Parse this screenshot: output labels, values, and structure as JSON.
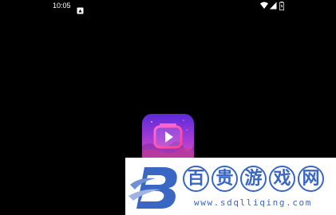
{
  "status_bar": {
    "time": "10:05",
    "icons": [
      "notification-icon",
      "wifi-icon",
      "cell-signal-icon",
      "battery-icon"
    ]
  },
  "splash": {
    "icon": "app-play-icon",
    "colors": {
      "gradient_top": "#7a3cff",
      "gradient_bottom": "#ff3fa4",
      "accent": "#ff4fb8"
    }
  },
  "watermark": {
    "logo": "baigui-logo",
    "title_chars": [
      "百",
      "贵",
      "游",
      "戏",
      "网"
    ],
    "url": "www.sdqlliqing.com",
    "color": "#3a67c4"
  }
}
